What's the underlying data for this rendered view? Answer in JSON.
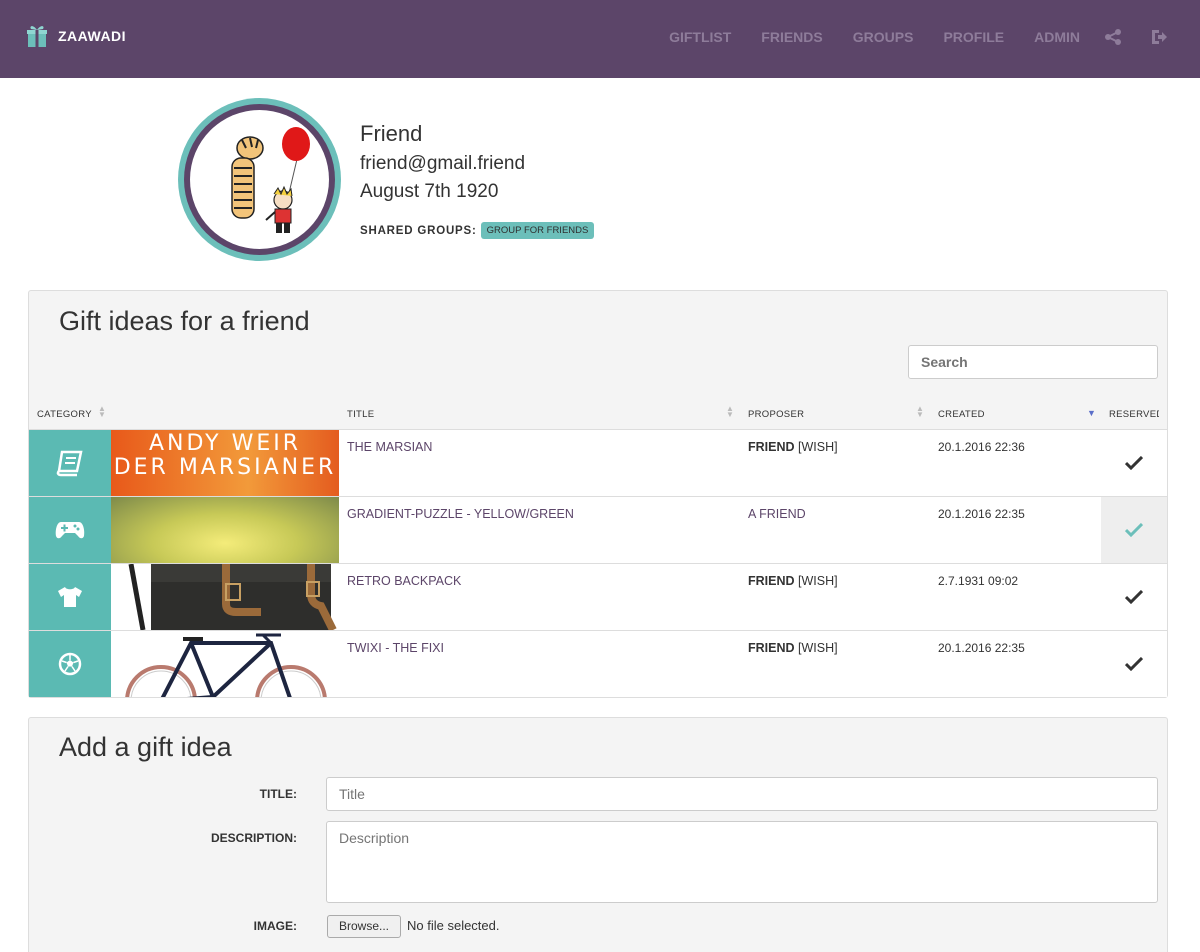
{
  "navbar": {
    "brand": "ZAAWADI",
    "items": [
      "GIFTLIST",
      "FRIENDS",
      "GROUPS",
      "PROFILE",
      "ADMIN"
    ],
    "icons": [
      "share-icon",
      "logout-icon"
    ],
    "colors": {
      "background": "#5c4569",
      "item": "#8e7c9a"
    }
  },
  "profile": {
    "name": "Friend",
    "email": "friend@gmail.friend",
    "birthday": "August 7th 1920",
    "shared_groups_label": "SHARED GROUPS:",
    "shared_groups": [
      "GROUP FOR FRIENDS"
    ]
  },
  "gifts": {
    "title": "Gift ideas for a friend",
    "search_placeholder": "Search",
    "columns": {
      "category": "CATEGORY",
      "title": "TITLE",
      "proposer": "PROPOSER",
      "created": "CREATED",
      "reserved": "RESERVED"
    },
    "rows": [
      {
        "category_icon": "book-icon",
        "thumb_text_1": "ANDY WEIR",
        "thumb_text_2": "DER MARSIANER",
        "title": "THE MARSIAN",
        "proposer": "FRIEND",
        "proposer_note": "[WISH]",
        "created": "20.1.2016 22:36",
        "reserved_icon": "check-icon"
      },
      {
        "category_icon": "gamepad-icon",
        "title": "GRADIENT-PUZZLE - YELLOW/GREEN",
        "proposer": "A FRIEND",
        "proposer_note": "",
        "created": "20.1.2016 22:35",
        "reserved_icon": "check-icon"
      },
      {
        "category_icon": "tshirt-icon",
        "thumb_text_1": "",
        "title": "RETRO BACKPACK",
        "proposer": "FRIEND",
        "proposer_note": "[WISH]",
        "created": "2.7.1931 09:02",
        "reserved_icon": "check-icon"
      },
      {
        "category_icon": "soccer-ball-icon",
        "title": "TWIXI - THE FIXI",
        "proposer": "FRIEND",
        "proposer_note": "[WISH]",
        "created": "20.1.2016 22:35",
        "reserved_icon": "check-icon"
      }
    ],
    "colors": {
      "category_bg": "#5bbab3",
      "link": "#5c4569",
      "check_dark": "#333333",
      "check_teal": "#6cbfba"
    }
  },
  "add_gift": {
    "title": "Add a gift idea",
    "title_label": "TITLE:",
    "title_placeholder": "Title",
    "description_label": "DESCRIPTION:",
    "description_placeholder": "Description",
    "image_label": "IMAGE:",
    "browse_label": "Browse...",
    "file_status": "No file selected."
  }
}
